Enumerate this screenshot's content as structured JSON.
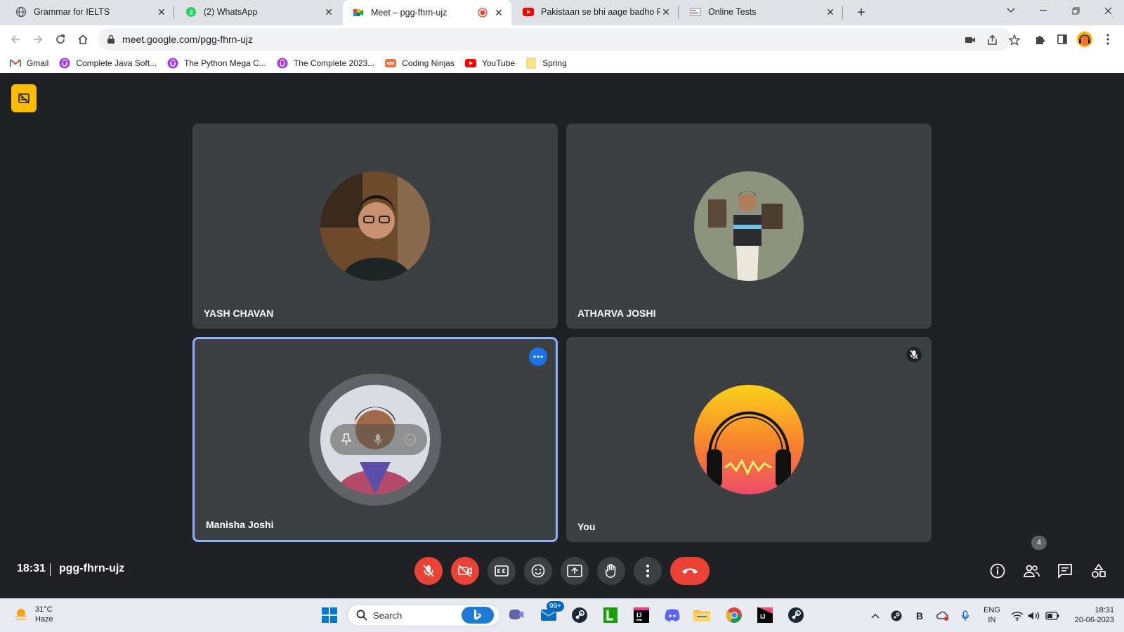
{
  "browser": {
    "tabs": [
      {
        "title": "Grammar for IELTS",
        "icon": "globe-icon"
      },
      {
        "title": "(2) WhatsApp",
        "icon": "whatsapp-icon"
      },
      {
        "title": "Meet – pgg-fhrn-ujz",
        "icon": "google-meet-icon",
        "active": true,
        "recording": true
      },
      {
        "title": "Pakistaan se bhi aage badho Path",
        "icon": "youtube-icon"
      },
      {
        "title": "Online Tests",
        "icon": "online-tests-icon"
      }
    ],
    "url": "meet.google.com/pgg-fhrn-ujz",
    "bookmarks": [
      {
        "label": "Gmail",
        "icon": "gmail-icon"
      },
      {
        "label": "Complete Java Soft...",
        "icon": "udemy-icon"
      },
      {
        "label": "The Python Mega C...",
        "icon": "udemy-icon"
      },
      {
        "label": "The Complete 2023...",
        "icon": "udemy-icon"
      },
      {
        "label": "Coding Ninjas",
        "icon": "coding-ninjas-icon"
      },
      {
        "label": "YouTube",
        "icon": "youtube-icon"
      },
      {
        "label": "Spring",
        "icon": "folder-icon"
      }
    ]
  },
  "meet": {
    "participants": [
      {
        "name": "YASH CHAVAN"
      },
      {
        "name": "ATHARVA JOSHI"
      },
      {
        "name": "Manisha Joshi",
        "speaking": true
      },
      {
        "name": "You",
        "muted": true
      }
    ],
    "time": "18:31",
    "meeting_code": "pgg-fhrn-ujz",
    "people_count": "4",
    "colors": {
      "accent": "#8ab4f8",
      "danger": "#ea4335",
      "tile": "#3c4043",
      "background": "#202124",
      "caption_badge": "#fbbc04"
    }
  },
  "taskbar": {
    "weather_temp": "31°C",
    "weather_desc": "Haze",
    "search_label": "Search",
    "mail_badge": "99+",
    "lang_top": "ENG",
    "lang_bottom": "IN",
    "time": "18:31",
    "date": "20-06-2023"
  }
}
